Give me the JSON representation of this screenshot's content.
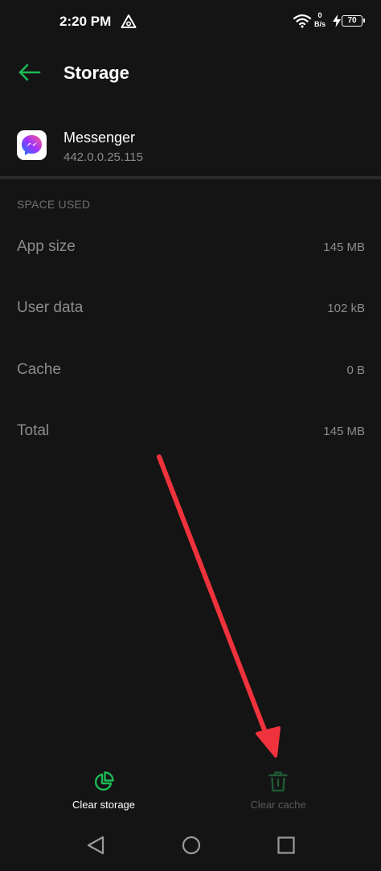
{
  "status_bar": {
    "time": "2:20 PM",
    "net_speed_value": "0",
    "net_speed_unit": "B/s",
    "battery": "70"
  },
  "app_bar": {
    "title": "Storage",
    "back_icon": "back-arrow-icon"
  },
  "app": {
    "name": "Messenger",
    "version": "442.0.0.25.115",
    "icon": "messenger-icon"
  },
  "space_used": {
    "header": "SPACE USED",
    "rows": [
      {
        "label": "App size",
        "value": "145 MB"
      },
      {
        "label": "User data",
        "value": "102 kB"
      },
      {
        "label": "Cache",
        "value": "0 B"
      },
      {
        "label": "Total",
        "value": "145 MB"
      }
    ]
  },
  "actions": {
    "clear_storage": {
      "label": "Clear storage",
      "icon": "pie-chart-icon"
    },
    "clear_cache": {
      "label": "Clear cache",
      "icon": "trash-icon"
    }
  },
  "colors": {
    "accent": "#1db954",
    "background": "#141414",
    "annotation_arrow": "#f0323c"
  },
  "nav": {
    "back_icon": "nav-back-icon",
    "home_icon": "nav-home-icon",
    "recents_icon": "nav-recents-icon"
  }
}
